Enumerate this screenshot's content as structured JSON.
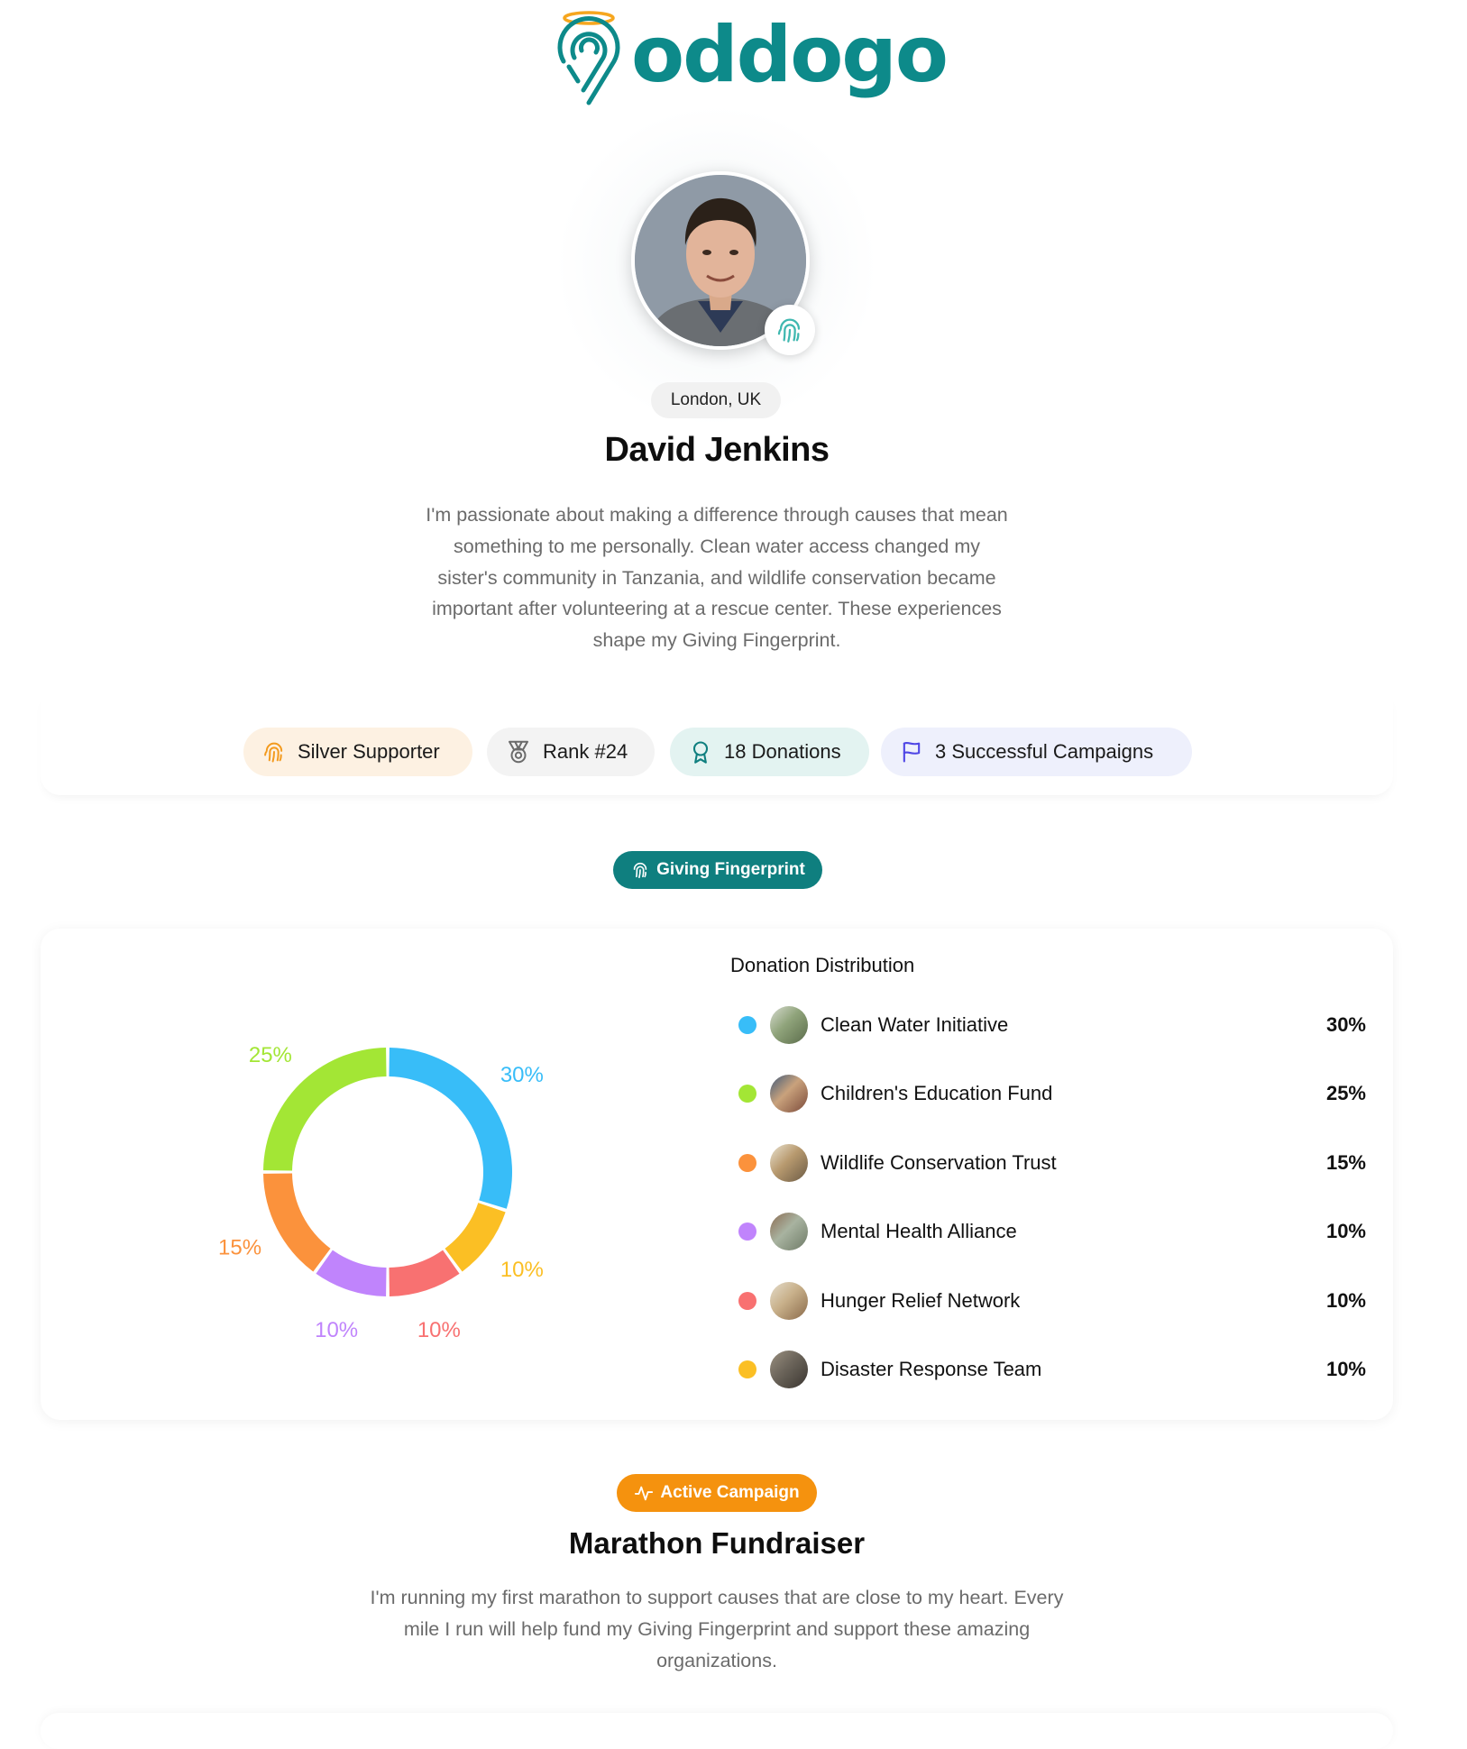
{
  "brand": {
    "name": "oddogo",
    "color": "#0d8a8a",
    "halo_color": "#f6a61e"
  },
  "profile": {
    "location": "London, UK",
    "name": "David Jenkins",
    "bio": "I'm passionate about making a difference through causes that mean something to me personally. Clean water access changed my sister's community in Tanzania, and wildlife conservation became important after volunteering at a rescue center. These experiences shape my Giving Fingerprint."
  },
  "stats": [
    {
      "label": "Silver Supporter",
      "icon": "fingerprint-icon",
      "color": "#f39a1d"
    },
    {
      "label": "Rank #24",
      "icon": "medal-icon",
      "color": "#6b6b6b"
    },
    {
      "label": "18 Donations",
      "icon": "award-ribbon-icon",
      "color": "#0f7f7f"
    },
    {
      "label": "3 Successful Campaigns",
      "icon": "flag-icon",
      "color": "#4f46e5"
    }
  ],
  "fingerprint_section": {
    "chip_label": "Giving Fingerprint"
  },
  "distribution": {
    "title": "Donation Distribution",
    "items": [
      {
        "name": "Clean Water Initiative",
        "pct": "30%",
        "color": "#38bdf8"
      },
      {
        "name": "Children's Education Fund",
        "pct": "25%",
        "color": "#a3e635"
      },
      {
        "name": "Wildlife Conservation Trust",
        "pct": "15%",
        "color": "#fb923c"
      },
      {
        "name": "Mental Health Alliance",
        "pct": "10%",
        "color": "#c084fc"
      },
      {
        "name": "Hunger Relief Network",
        "pct": "10%",
        "color": "#f87171"
      },
      {
        "name": "Disaster Response Team",
        "pct": "10%",
        "color": "#fbbf24"
      }
    ]
  },
  "chart_data": {
    "type": "pie",
    "categories": [
      "Clean Water Initiative",
      "Disaster Response Team",
      "Hunger Relief Network",
      "Mental Health Alliance",
      "Wildlife Conservation Trust",
      "Children's Education Fund"
    ],
    "values": [
      30,
      10,
      10,
      10,
      15,
      25
    ],
    "labels": [
      "30%",
      "10%",
      "10%",
      "10%",
      "15%",
      "25%"
    ],
    "colors": [
      "#38bdf8",
      "#fbbf24",
      "#f87171",
      "#c084fc",
      "#fb923c",
      "#a3e635"
    ]
  },
  "campaign": {
    "chip_label": "Active Campaign",
    "title": "Marathon Fundraiser",
    "description": "I'm running my first marathon to support causes that are close to my heart. Every mile I run will help fund my Giving Fingerprint and support these amazing organizations."
  }
}
